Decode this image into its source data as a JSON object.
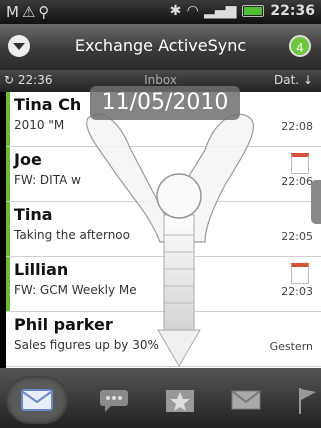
{
  "status_bar": {
    "icons": [
      "gmail-icon",
      "warning-icon",
      "usb-icon",
      "bluetooth-icon",
      "wifi-icon",
      "signal-icon",
      "battery-icon"
    ],
    "time": "22:36"
  },
  "header": {
    "title": "Exchange ActiveSync",
    "unread_count": "4"
  },
  "subheader": {
    "sync_time": "22:36",
    "folder": "Inbox",
    "sort": "Dat."
  },
  "date_overlay": "11/05/2010",
  "messages": [
    {
      "sender": "Tina Ch",
      "preview": "2010 \"M",
      "time": "22:08",
      "unread": true
    },
    {
      "sender": "Joe",
      "preview": "FW: DITA w",
      "time": "22:06",
      "unread": true,
      "has_calendar": true
    },
    {
      "sender": "Tina",
      "preview": "Taking the afternoo",
      "time": "22:05",
      "unread": true
    },
    {
      "sender": "Lillian",
      "preview": "FW: GCM Weekly Me",
      "time": "22:03",
      "unread": true,
      "has_calendar": true
    },
    {
      "sender": "Phil parker",
      "preview": "Sales figures up by 30%",
      "time": "Gestern",
      "unread": false
    }
  ],
  "tabs": [
    "inbox-icon",
    "conversation-icon",
    "starred-icon",
    "unread-icon",
    "flag-icon"
  ],
  "colors": {
    "unread_bar": "#6bbf2f",
    "badge": "#6bc83a"
  }
}
